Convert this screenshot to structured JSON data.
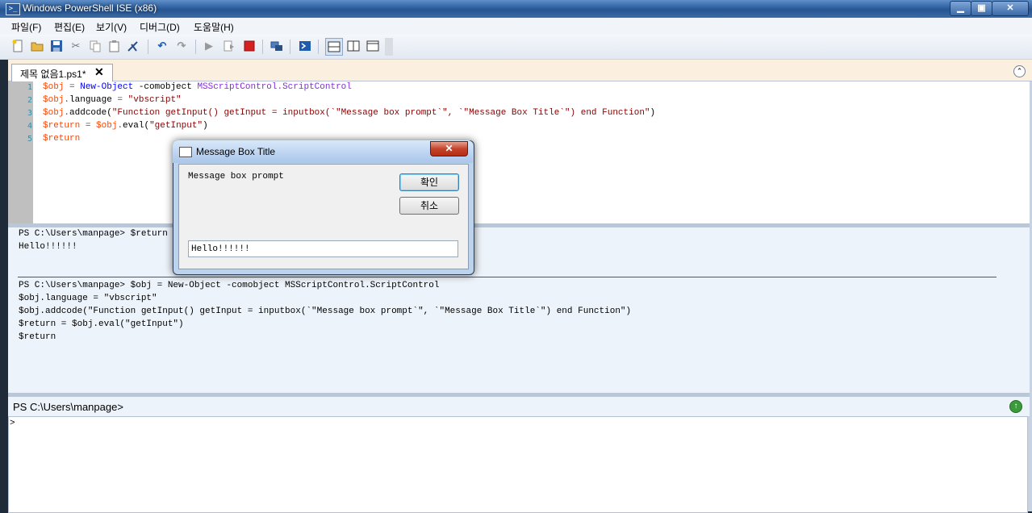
{
  "window": {
    "title": "Windows PowerShell ISE (x86)",
    "app_icon": ">_",
    "minimize": "▁",
    "maximize": "▣",
    "close": "✕"
  },
  "menu": [
    "파일(F)",
    "편집(E)",
    "보기(V)",
    "디버그(D)",
    "도움말(H)"
  ],
  "toolbar": {
    "icons": [
      "new-icon",
      "open-icon",
      "save-icon",
      "cut-icon",
      "copy-icon",
      "paste-icon",
      "clear-icon",
      "undo-icon",
      "redo-icon",
      "run-icon",
      "run-selection-icon",
      "stop-icon",
      "remote-icon",
      "powershell-icon",
      "layout-top-icon",
      "layout-right-icon",
      "layout-max-icon"
    ]
  },
  "tab": {
    "label": "제목 없음1.ps1*",
    "close": "✕",
    "collapse": "⌃"
  },
  "editor": {
    "line_numbers": [
      "1",
      "2",
      "3",
      "4",
      "5"
    ],
    "lines": [
      [
        {
          "c": "v",
          "t": "$obj"
        },
        {
          "c": "o",
          "t": " = "
        },
        {
          "c": "k",
          "t": "New-Object"
        },
        {
          "c": "p",
          "t": " -comobject "
        },
        {
          "c": "t",
          "t": "MSScriptControl.ScriptControl"
        }
      ],
      [
        {
          "c": "v",
          "t": "$obj"
        },
        {
          "c": "o",
          "t": "."
        },
        {
          "c": "p",
          "t": "language"
        },
        {
          "c": "o",
          "t": " = "
        },
        {
          "c": "s",
          "t": "\"vbscript\""
        }
      ],
      [
        {
          "c": "v",
          "t": "$obj"
        },
        {
          "c": "o",
          "t": "."
        },
        {
          "c": "p",
          "t": "addcode("
        },
        {
          "c": "s",
          "t": "\"Function getInput() getInput = inputbox(`\"Message box prompt`\", `\"Message Box Title`\") end Function\""
        },
        {
          "c": "p",
          "t": ")"
        }
      ],
      [
        {
          "c": "v",
          "t": "$return"
        },
        {
          "c": "o",
          "t": " = "
        },
        {
          "c": "v",
          "t": "$obj"
        },
        {
          "c": "o",
          "t": "."
        },
        {
          "c": "p",
          "t": "eval("
        },
        {
          "c": "s",
          "t": "\"getInput\""
        },
        {
          "c": "p",
          "t": ")"
        }
      ],
      [
        {
          "c": "v",
          "t": "$return"
        }
      ]
    ]
  },
  "output": {
    "block1": [
      "PS C:\\Users\\manpage> $return",
      "Hello!!!!!!"
    ],
    "block2": [
      "PS C:\\Users\\manpage> $obj = New-Object -comobject MSScriptControl.ScriptControl",
      "$obj.language = \"vbscript\"",
      "$obj.addcode(\"Function getInput() getInput = inputbox(`\"Message box prompt`\", `\"Message Box Title`\") end Function\")",
      "$return = $obj.eval(\"getInput\")",
      "$return"
    ]
  },
  "command_pane": {
    "prompt": "PS C:\\Users\\manpage>",
    "caret": ">",
    "run_icon": "↑"
  },
  "dialog": {
    "title": "Message Box Title",
    "close": "✕",
    "prompt": "Message box prompt",
    "ok_label": "확인",
    "cancel_label": "취소",
    "input_value": "Hello!!!!!!"
  },
  "colors": {
    "variable": "#ff4500",
    "keyword": "#0000ff",
    "type": "#8a2be2",
    "string": "#8b0000"
  }
}
